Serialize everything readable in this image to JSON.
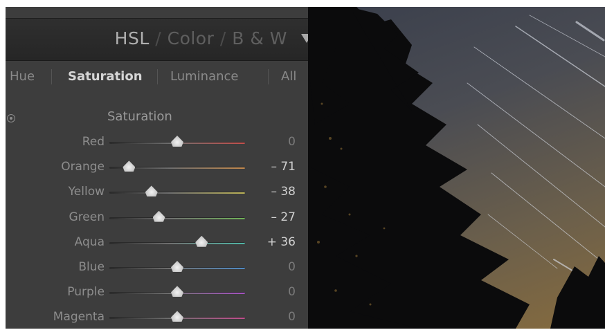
{
  "header": {
    "tabs": [
      {
        "label": "HSL",
        "active": true
      },
      {
        "label": "Color",
        "active": false
      },
      {
        "label": "B & W",
        "active": false
      }
    ],
    "separator": "/",
    "menu_icon": "triangle-down-icon"
  },
  "subtabs": [
    {
      "label": "Hue",
      "active": false
    },
    {
      "label": "Saturation",
      "active": true
    },
    {
      "label": "Luminance",
      "active": false
    },
    {
      "label": "All",
      "active": false
    }
  ],
  "section": {
    "title": "Saturation",
    "adjust_icon": "target-adjust-icon"
  },
  "sliders": [
    {
      "name": "red",
      "label": "Red",
      "value": 0,
      "display": "0",
      "color": "#c4504c"
    },
    {
      "name": "orange",
      "label": "Orange",
      "value": -71,
      "display": "– 71",
      "color": "#c48a4e"
    },
    {
      "name": "yellow",
      "label": "Yellow",
      "value": -38,
      "display": "– 38",
      "color": "#bdb457"
    },
    {
      "name": "green",
      "label": "Green",
      "value": -27,
      "display": "– 27",
      "color": "#6fb257"
    },
    {
      "name": "aqua",
      "label": "Aqua",
      "value": 36,
      "display": "+ 36",
      "color": "#4fb5a5"
    },
    {
      "name": "blue",
      "label": "Blue",
      "value": 0,
      "display": "0",
      "color": "#4f8ac4"
    },
    {
      "name": "purple",
      "label": "Purple",
      "value": 0,
      "display": "0",
      "color": "#a452c0"
    },
    {
      "name": "magenta",
      "label": "Magenta",
      "value": 0,
      "display": "0",
      "color": "#c24f8f"
    }
  ],
  "slider_range": [
    -100,
    100
  ],
  "photo": {
    "subject": "star-trails-trees-photo"
  }
}
